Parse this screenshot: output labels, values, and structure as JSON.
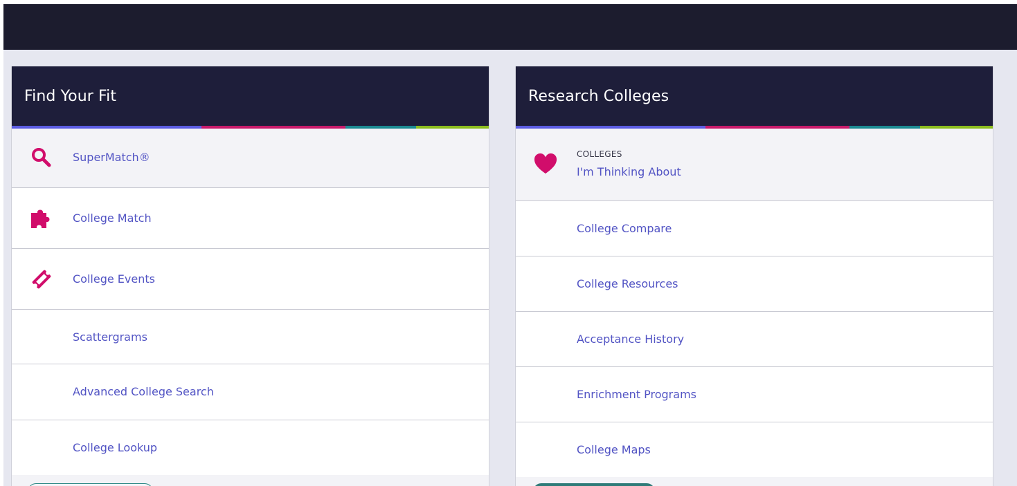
{
  "left_card": {
    "title": "Find Your Fit",
    "items": [
      {
        "label": "SuperMatch®",
        "icon": "search-icon"
      },
      {
        "label": "College Match",
        "icon": "puzzle-icon"
      },
      {
        "label": "College Events",
        "icon": "ticket-icon"
      },
      {
        "label": "Scattergrams"
      },
      {
        "label": "Advanced College Search"
      },
      {
        "label": "College Lookup"
      }
    ]
  },
  "right_card": {
    "title": "Research Colleges",
    "featured": {
      "overline": "COLLEGES",
      "label": "I'm Thinking About",
      "icon": "heart-icon"
    },
    "items": [
      {
        "label": "College Compare"
      },
      {
        "label": "College Resources"
      },
      {
        "label": "Acceptance History"
      },
      {
        "label": "Enrichment Programs"
      },
      {
        "label": "College Maps"
      }
    ]
  },
  "colors": {
    "header_bg": "#1e1e3a",
    "topbar_bg": "#1c1c2e",
    "link": "#5254c4",
    "accent_pink": "#d10d6b",
    "stripe": [
      "#5b5ce2",
      "#c81a6a",
      "#1b8a92",
      "#8cbd1e"
    ]
  }
}
